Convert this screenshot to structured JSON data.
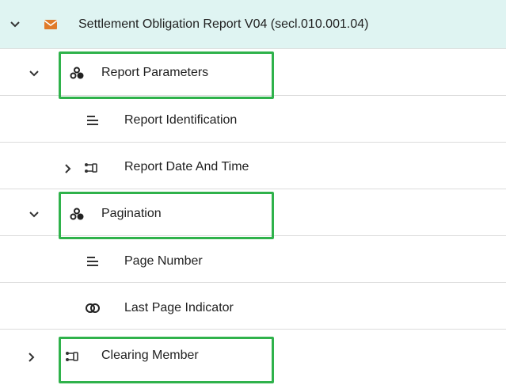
{
  "tree": {
    "root": {
      "label": "Settlement Obligation Report V04 (secl.010.001.04)",
      "icon": "envelope-icon",
      "expanded": true
    },
    "items": [
      {
        "label": "Report Parameters",
        "icon": "component-group-icon",
        "expanded": true,
        "highlighted": true
      },
      {
        "label": "Report Identification",
        "icon": "text-lines-icon"
      },
      {
        "label": "Report Date And Time",
        "icon": "choice-branch-icon",
        "expanded": false
      },
      {
        "label": "Pagination",
        "icon": "component-group-icon",
        "expanded": true,
        "highlighted": true
      },
      {
        "label": "Page Number",
        "icon": "text-lines-icon"
      },
      {
        "label": "Last Page Indicator",
        "icon": "toggle-indicator-icon"
      },
      {
        "label": "Clearing Member",
        "icon": "choice-branch-icon",
        "expanded": false,
        "highlighted": true
      }
    ]
  },
  "colors": {
    "root_bg": "#dff4f2",
    "highlight": "#2fb24b",
    "envelope": "#e07b2a",
    "divider": "#dcdcdc"
  }
}
